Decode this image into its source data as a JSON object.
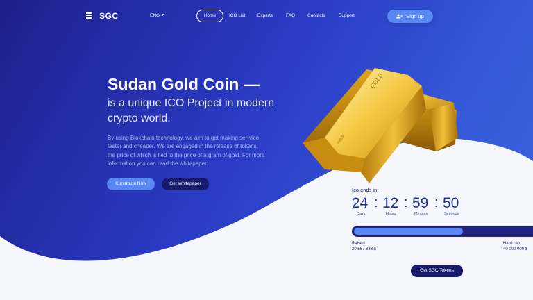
{
  "nav": {
    "logo": "SGC",
    "language": "ENG",
    "links": [
      "Home",
      "ICO List",
      "Experts",
      "FAQ",
      "Contacts",
      "Support"
    ],
    "signup": "Sign up"
  },
  "hero": {
    "headline": "Sudan Gold Coin —",
    "subline": "is a unique ICO Project in modern crypto world.",
    "description": "By using Blokchain technology, we aim to get making ser-vice faster and cheaper. We are engaged in the release of tokens, the price of which is tied to the price of a gram of gold. For more information you can read the whitepaper.",
    "contribute_button": "Contribute Now",
    "whitepaper_button": "Get Whitepaper"
  },
  "countdown": {
    "label": "Ico ends in:",
    "days": "24",
    "hours": "12",
    "minutes": "59",
    "seconds": "50",
    "separator": ":",
    "units": [
      "Days",
      "Hours",
      "Minutes",
      "Seconds"
    ]
  },
  "progress": {
    "fraction": 0.595,
    "raised_label": "Raised",
    "raised_value": "20 567 833 $",
    "cap_label": "Hard cap",
    "cap_value": "40 000 000 $"
  },
  "tokens_button": "Get SGC Tokens",
  "colors": {
    "accent": "#5a88f3",
    "dark_navy": "#171a6a",
    "gradient_start": "#1e1f8c",
    "gradient_end": "#3c68e0",
    "gold": "#e6b422"
  },
  "icons": [
    "hamburger-menu-icon",
    "caret-down-icon",
    "user-plus-icon"
  ]
}
